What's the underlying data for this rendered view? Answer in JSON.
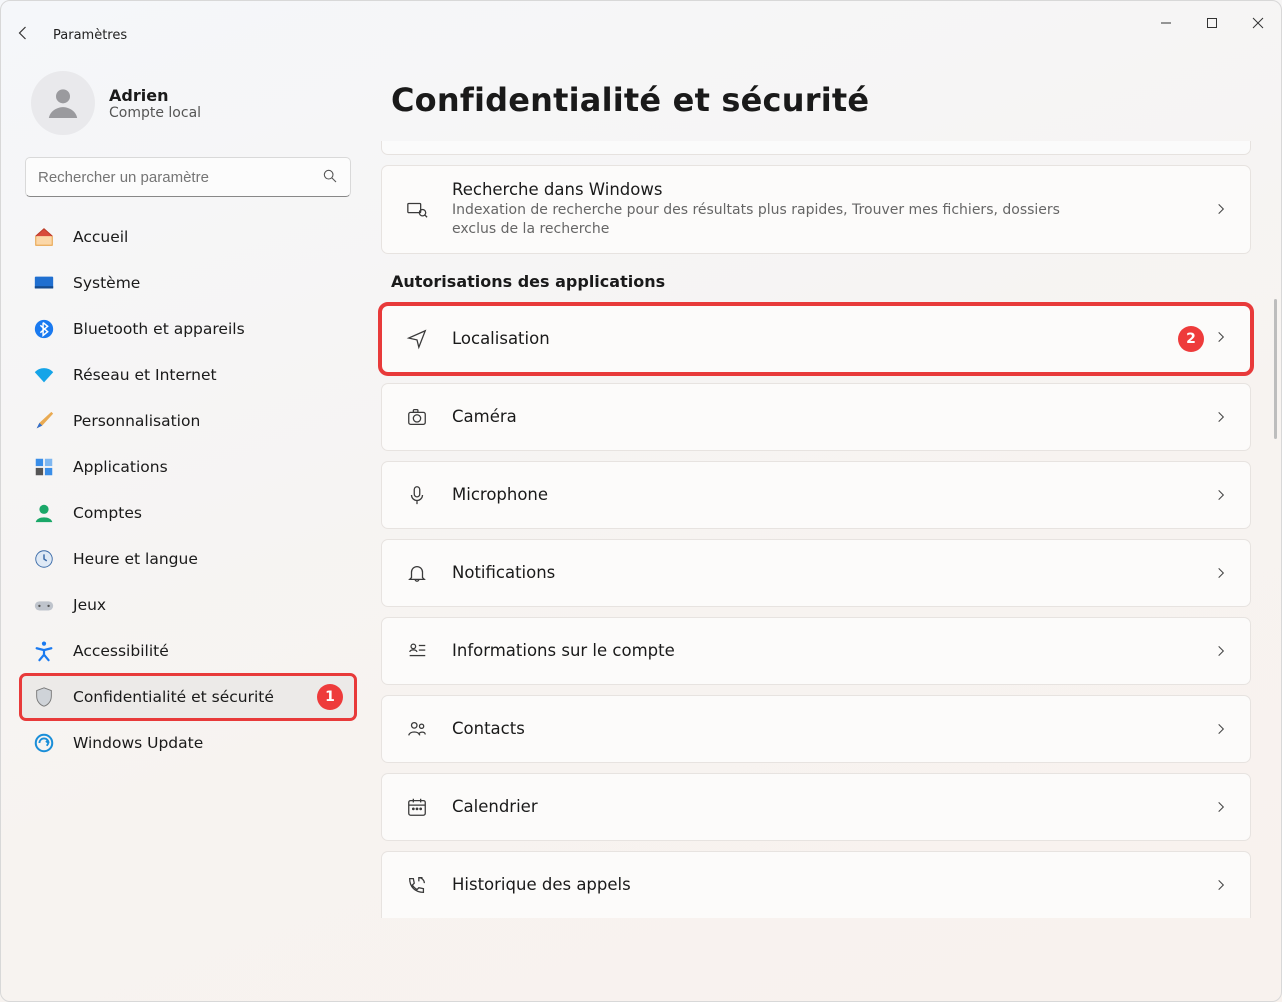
{
  "app": {
    "title": "Paramètres"
  },
  "user": {
    "name": "Adrien",
    "subtitle": "Compte local"
  },
  "search": {
    "placeholder": "Rechercher un paramètre"
  },
  "sidebar": {
    "items": [
      {
        "label": "Accueil"
      },
      {
        "label": "Système"
      },
      {
        "label": "Bluetooth et appareils"
      },
      {
        "label": "Réseau et Internet"
      },
      {
        "label": "Personnalisation"
      },
      {
        "label": "Applications"
      },
      {
        "label": "Comptes"
      },
      {
        "label": "Heure et langue"
      },
      {
        "label": "Jeux"
      },
      {
        "label": "Accessibilité"
      },
      {
        "label": "Confidentialité et sécurité"
      },
      {
        "label": "Windows Update"
      }
    ]
  },
  "annotations": {
    "sidebar_badge": "1",
    "location_badge": "2"
  },
  "page": {
    "title": "Confidentialité et sécurité",
    "search_card": {
      "title": "Recherche dans Windows",
      "subtitle": "Indexation de recherche pour des résultats plus rapides, Trouver mes fichiers, dossiers exclus de la recherche"
    },
    "section_label": "Autorisations des applications",
    "permissions": [
      {
        "label": "Localisation"
      },
      {
        "label": "Caméra"
      },
      {
        "label": "Microphone"
      },
      {
        "label": "Notifications"
      },
      {
        "label": "Informations sur le compte"
      },
      {
        "label": "Contacts"
      },
      {
        "label": "Calendrier"
      },
      {
        "label": "Historique des appels"
      }
    ]
  }
}
